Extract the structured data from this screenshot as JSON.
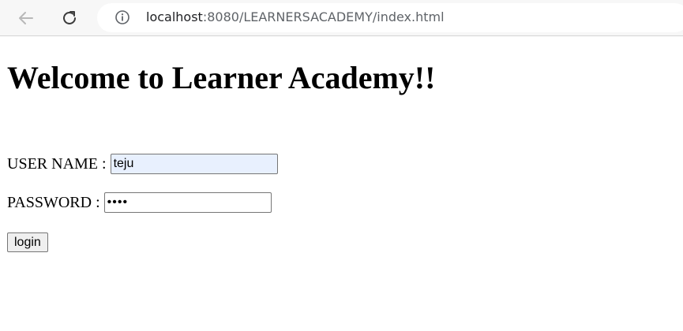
{
  "browser": {
    "url_host": "localhost",
    "url_path": ":8080/LEARNERSACADEMY/index.html"
  },
  "page": {
    "heading": "Welcome to Learner Academy!!",
    "username_label": "USER NAME :",
    "username_value": "teju",
    "password_label": "PASSWORD :",
    "password_value": "teju",
    "login_label": "login"
  },
  "colors": {
    "autofill_background": "#e8f0fe",
    "toolbar_background": "#f7f7f7"
  },
  "icons": {
    "back": "back-arrow-icon",
    "reload": "reload-icon",
    "info": "info-icon"
  }
}
